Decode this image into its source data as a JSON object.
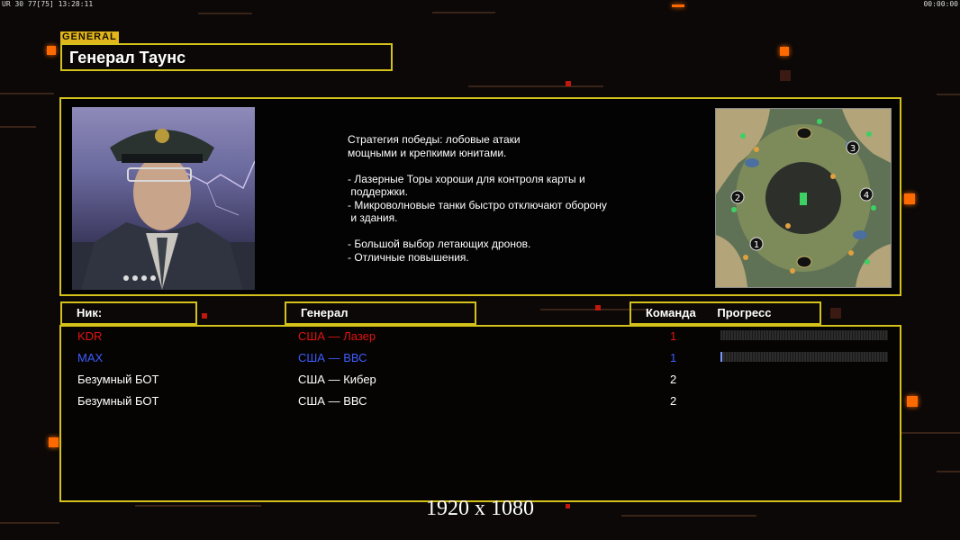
{
  "hud": {
    "left": "UR 30 77[75] 13:28:11",
    "right": "00:00:00"
  },
  "general_tag": "GENERAL",
  "general_name": "Генерал Таунс",
  "description": "Стратегия победы: лобовые атаки\nмощными и крепкими юнитами.\n\n- Лазерные Торы хороши для контроля карты и\n поддержки.\n- Микроволновые танки быстро отключают оборону\n и здания.\n\n- Большой выбор летающих дронов.\n- Отличные повышения.",
  "map": {
    "start_positions": [
      "1",
      "2",
      "3",
      "4"
    ]
  },
  "columns": {
    "nick": "Ник:",
    "general": "Генерал",
    "team": "Команда",
    "progress": "Прогресс"
  },
  "players": [
    {
      "nick": "KDR",
      "general": "США — Лазер",
      "team": "1",
      "color": "#e0140e",
      "progress": 0.0
    },
    {
      "nick": "MAX",
      "general": "США — ВВС",
      "team": "1",
      "color": "#3c5cff",
      "progress": 0.01
    },
    {
      "nick": "Безумный БОТ",
      "general": "США — Кибер",
      "team": "2",
      "color": "#ffffff"
    },
    {
      "nick": "Безумный БОТ",
      "general": "США — ВВС",
      "team": "2",
      "color": "#ffffff"
    }
  ],
  "resolution": "1920 x 1080",
  "colors": {
    "accent": "#d4c11a",
    "orange": "#ff6a00"
  }
}
